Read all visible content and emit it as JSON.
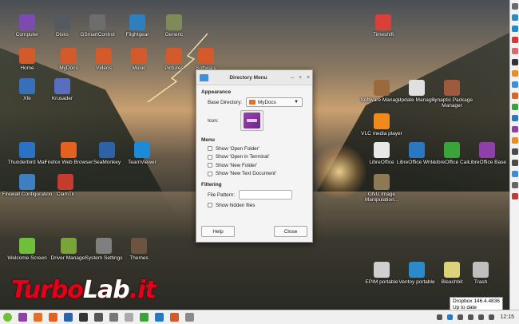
{
  "desktop": {
    "icons_left": [
      {
        "label": "Computer",
        "color": "#7a4cb0"
      },
      {
        "label": "Disks",
        "color": "#555a60"
      },
      {
        "label": "GSmartControl",
        "color": "#6d6d6d"
      },
      {
        "label": "Flightgear",
        "color": "#2f7fbf"
      },
      {
        "label": "Generic",
        "color": "#7f8a5a"
      },
      {
        "label": "Home",
        "color": "#d35a2a"
      },
      {
        "label": "MyDocs",
        "color": "#d35a2a"
      },
      {
        "label": "Videos",
        "color": "#d35a2a"
      },
      {
        "label": "Music",
        "color": "#d35a2a"
      },
      {
        "label": "Pictures",
        "color": "#d35a2a"
      },
      {
        "label": "Software",
        "color": "#d35a2a"
      },
      {
        "label": "Xfe",
        "color": "#3870b8"
      },
      {
        "label": "Krusader",
        "color": "#5a6ebf"
      },
      {
        "label": "Thunderbird Mail",
        "color": "#2a73c4"
      },
      {
        "label": "Firefox Web Browser",
        "color": "#e3621f"
      },
      {
        "label": "SeaMonkey",
        "color": "#2d62a8"
      },
      {
        "label": "TeamViewer",
        "color": "#1b8ad8"
      },
      {
        "label": "Firewall Configuration",
        "color": "#3f7ec0"
      },
      {
        "label": "ClamTk",
        "color": "#c43b2f"
      },
      {
        "label": "Welcome Screen",
        "color": "#6fbf3b"
      },
      {
        "label": "Driver Manager",
        "color": "#7aa33a"
      },
      {
        "label": "System Settings",
        "color": "#7f7f7f"
      },
      {
        "label": "Themes",
        "color": "#6d5440"
      }
    ],
    "icons_right": [
      {
        "label": "Timeshift",
        "color": "#d8413a"
      },
      {
        "label": "Software Manager",
        "color": "#9b6a3c"
      },
      {
        "label": "Update Manager",
        "color": "#e0e0e0"
      },
      {
        "label": "Synaptic Package Manager",
        "color": "#9e5a3b"
      },
      {
        "label": "VLC media player",
        "color": "#f08a1c"
      },
      {
        "label": "LibreOffice",
        "color": "#e8e8e8"
      },
      {
        "label": "LibreOffice Writer",
        "color": "#2a78c2"
      },
      {
        "label": "LibreOffice Calc",
        "color": "#3aa33a"
      },
      {
        "label": "LibreOffice Base",
        "color": "#8e3fa8"
      },
      {
        "label": "GNU Image Manipulation...",
        "color": "#8c7a55"
      },
      {
        "label": "EPIM portable",
        "color": "#cfcfcf"
      },
      {
        "label": "Ventoy portable",
        "color": "#2a8acb"
      },
      {
        "label": "Bleachbit",
        "color": "#dbd27a"
      },
      {
        "label": "Trash",
        "color": "#bfbfbf"
      }
    ]
  },
  "watermark": {
    "part1": "Turbo",
    "part2": "Lab",
    "part3": ".it"
  },
  "dialog": {
    "title": "Directory Menu",
    "window_buttons": {
      "minimize": "–",
      "maximize": "+",
      "close": "×"
    },
    "appearance_heading": "Appearance",
    "base_dir_label": "Base Directory:",
    "base_dir_value": "MyDocs",
    "icon_label": "Icon:",
    "menu_heading": "Menu",
    "options": [
      "Show 'Open Folder'",
      "Show 'Open in Terminal'",
      "Show 'New Folder'",
      "Show 'New Text Document'"
    ],
    "filtering_heading": "Filtering",
    "file_pattern_label": "File Pattern:",
    "file_pattern_value": "",
    "show_hidden_label": "Show hidden files",
    "help_button": "Help",
    "close_button": "Close"
  },
  "tooltip": {
    "line1": "Dropbox 146.4.4836",
    "line2": "Up to date"
  },
  "taskbar": {
    "clock": "12:15"
  },
  "colors": {
    "accent": "#e3001b",
    "dialog_bg": "#f4f4f4",
    "folder": "#e1702a"
  }
}
